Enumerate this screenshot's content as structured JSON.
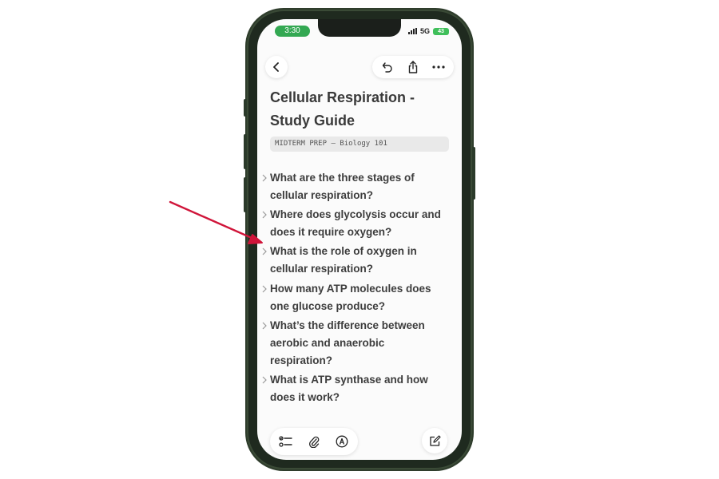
{
  "status_bar": {
    "time": "3:30",
    "network": "5G",
    "battery": "43"
  },
  "nav": {
    "back_icon": "chevron-left-icon",
    "undo_icon": "undo-icon",
    "share_icon": "share-icon",
    "more_icon": "more-horizontal-icon"
  },
  "note": {
    "title": "Cellular Respiration - Study Guide",
    "tag": "MIDTERM PREP — Biology 101",
    "questions": [
      {
        "line1": "What are the three stages of",
        "line2": "cellular respiration?"
      },
      {
        "line1": "Where does glycolysis occur and",
        "line2": "does it require oxygen?"
      },
      {
        "line1": "What is the role of oxygen in",
        "line2": "cellular respiration?"
      },
      {
        "line1": "How many ATP molecules does",
        "line2": "one glucose produce?"
      },
      {
        "line1": "What’s the difference between",
        "line2": "aerobic and anaerobic",
        "line3": "respiration?"
      },
      {
        "line1": "What is ATP synthase and how",
        "line2": "does it work?"
      }
    ]
  },
  "toolbar": {
    "checklist_icon": "checklist-icon",
    "attach_icon": "paperclip-icon",
    "markup_icon": "markup-pen-icon",
    "compose_icon": "compose-icon"
  },
  "colors": {
    "status_green": "#33a852",
    "annotation_arrow": "#d0153a",
    "text": "#3d3d3d"
  }
}
